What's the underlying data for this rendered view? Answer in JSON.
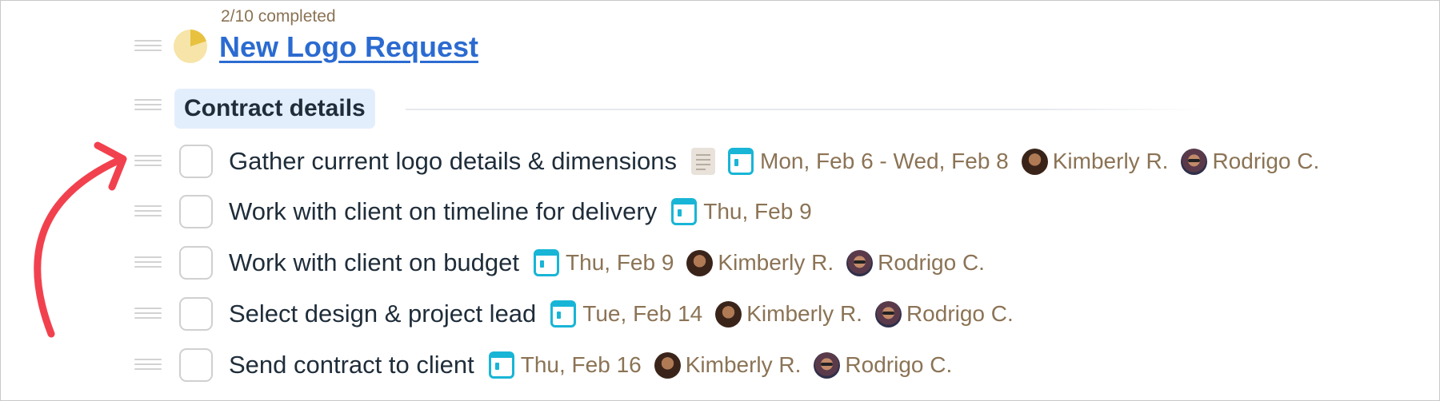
{
  "project": {
    "progress_text": "2/10 completed",
    "progress_fraction": 0.2,
    "title": "New Logo Request"
  },
  "section": {
    "title": "Contract details"
  },
  "colors": {
    "accent_link": "#2b6bd1",
    "meta_text": "#8b7355",
    "calendar": "#18b5d6",
    "annotation_arrow": "#f2414e"
  },
  "tasks": [
    {
      "name": "Gather current logo details & dimensions",
      "has_note": true,
      "date": "Mon, Feb 6 - Wed, Feb 8",
      "assignees": [
        "Kimberly R.",
        "Rodrigo C."
      ]
    },
    {
      "name": "Work with client on timeline for delivery",
      "has_note": false,
      "date": "Thu, Feb 9",
      "assignees": []
    },
    {
      "name": "Work with client on budget",
      "has_note": false,
      "date": "Thu, Feb 9",
      "assignees": [
        "Kimberly R.",
        "Rodrigo C."
      ]
    },
    {
      "name": "Select design & project lead",
      "has_note": false,
      "date": "Tue, Feb 14",
      "assignees": [
        "Kimberly R.",
        "Rodrigo C."
      ]
    },
    {
      "name": "Send contract to client",
      "has_note": false,
      "date": "Thu, Feb 16",
      "assignees": [
        "Kimberly R.",
        "Rodrigo C."
      ]
    }
  ]
}
